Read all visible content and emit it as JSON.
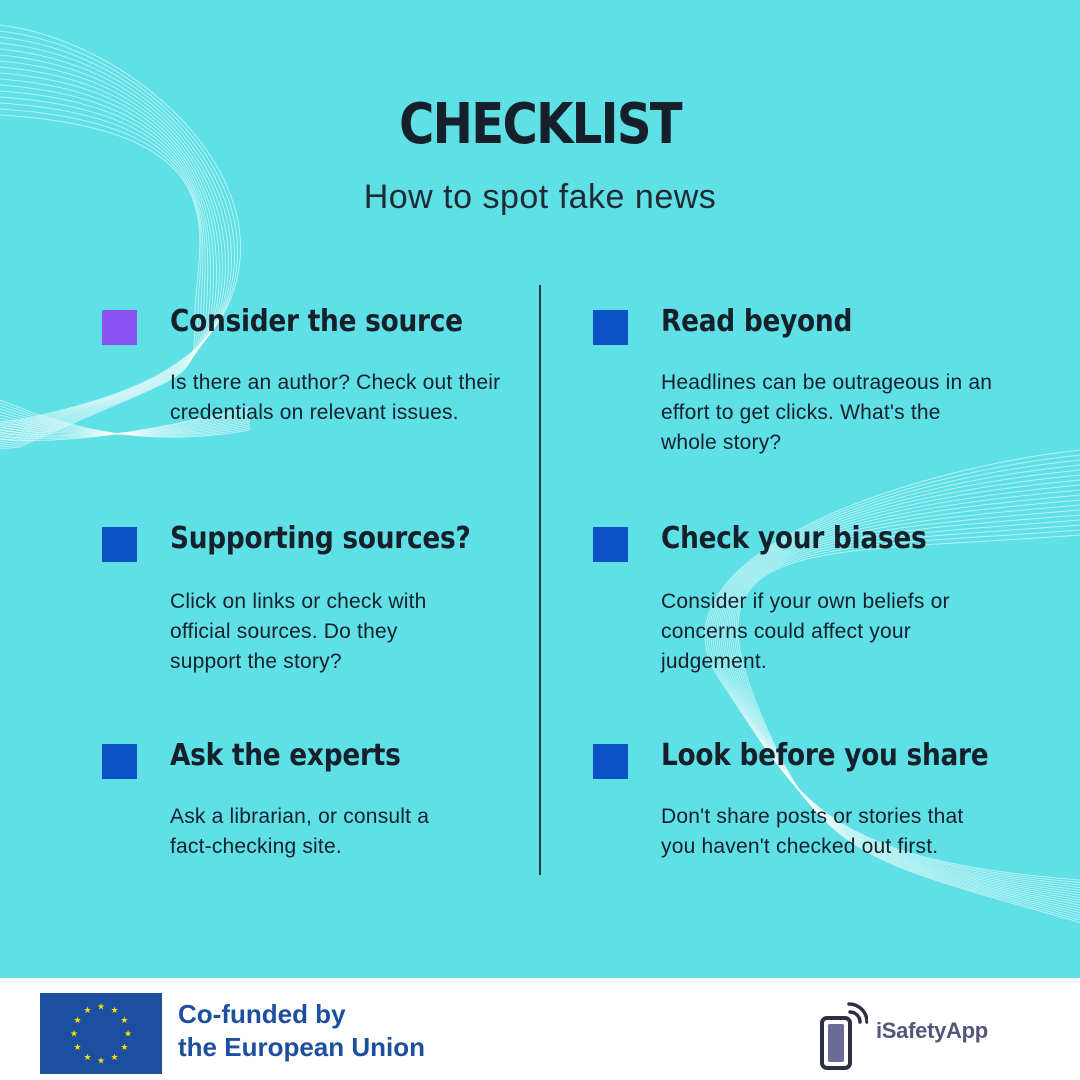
{
  "header": {
    "title": "CHECKLIST",
    "subtitle": "How to spot fake news"
  },
  "items": [
    {
      "title": "Consider the source",
      "description": "Is there an author? Check out their credentials on relevant issues.",
      "marker_color": "#8b52f5"
    },
    {
      "title": "Read beyond",
      "description": "Headlines can be outrageous in an effort to get clicks. What's the whole story?",
      "marker_color": "#0a52c6"
    },
    {
      "title": "Supporting sources?",
      "description": "Click on links or check with official sources. Do they support the story?",
      "marker_color": "#0a52c6"
    },
    {
      "title": "Check your biases",
      "description": "Consider if your own beliefs or concerns could affect your judgement.",
      "marker_color": "#0a52c6"
    },
    {
      "title": "Ask the experts",
      "description": "Ask a librarian, or consult a fact-checking site.",
      "marker_color": "#0a52c6"
    },
    {
      "title": "Look before you share",
      "description": "Don't share posts or stories that you haven't checked out first.",
      "marker_color": "#0a52c6"
    }
  ],
  "footer": {
    "eu_line1": "Co-funded by",
    "eu_line2": "the European Union",
    "app_name": "iSafetyApp"
  },
  "colors": {
    "background": "#5ee0e6",
    "text": "#16202a",
    "eu_blue": "#1d4fa0",
    "eu_star": "#ffdd00"
  },
  "icons": {
    "eu_flag": "eu-flag-icon",
    "app_logo": "phone-signal-icon"
  }
}
